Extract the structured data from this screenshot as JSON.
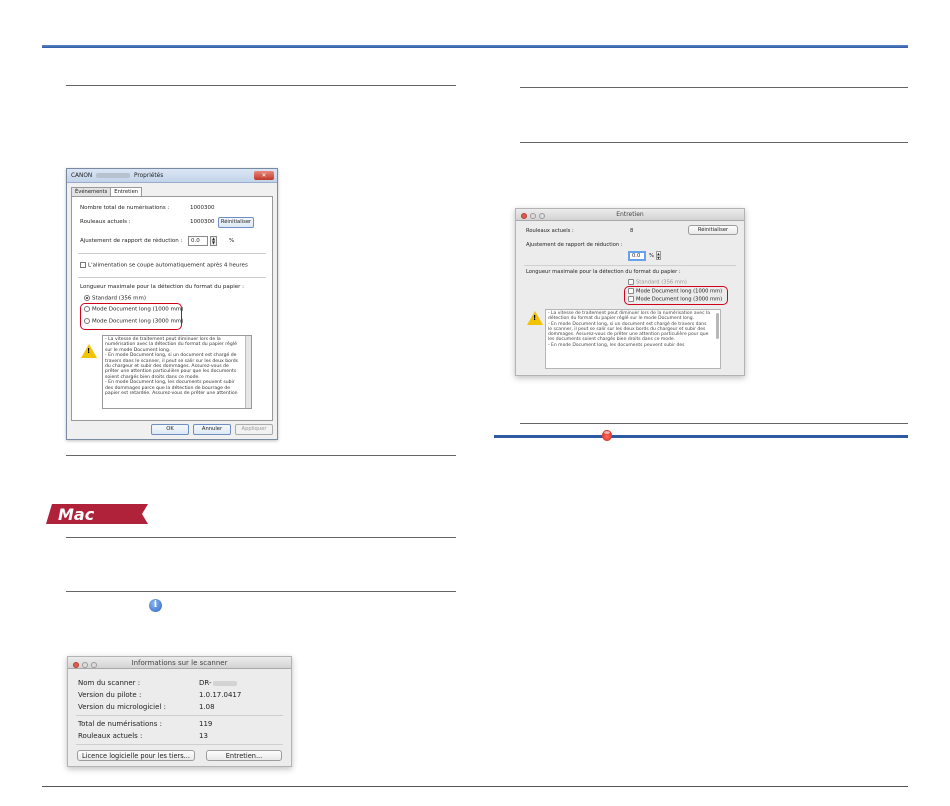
{
  "windows_dialog": {
    "title_prefix": "CANON",
    "title_suffix": "Propriétés",
    "close": "✕",
    "tabs": [
      "Événements",
      "Entretien"
    ],
    "total_scans_label": "Nombre total de numérisations :",
    "total_scans_value": "1000300",
    "rollers_label": "Rouleaux actuels :",
    "rollers_value": "1000300",
    "reset_button": "Réinitialiser",
    "reduction_label": "Ajustement de rapport de réduction :",
    "reduction_value": "0.0",
    "reduction_unit": "%",
    "power_off_label": "L'alimentation se coupe automatiquement après 4 heures",
    "max_length_label": "Longueur maximale pour la détection du format du papier :",
    "options": [
      "Standard (356 mm)",
      "Mode Document long (1000 mm)",
      "Mode Document long (3000 mm)"
    ],
    "message": "- La vitesse de traitement peut diminuer lors de la numérisation avec la détection du format du papier réglé sur le mode Document long.\n- En mode Document long, si un document est chargé de travers dans le scanner, il peut se salir sur les deux bords du chargeur et subir des dommages. Assurez-vous de prêter une attention particulière pour que les documents soient chargés bien droits dans ce mode.\n- En mode Document long, les documents peuvent subir des dommages parce que la détection de bourrage de papier est retardée. Assurez-vous de prêter une attention",
    "ok_button": "OK",
    "cancel_button": "Annuler",
    "apply_button": "Appliquer"
  },
  "mac_logo": {
    "text": "Mac",
    "color": "#b0213a"
  },
  "mac_maintenance": {
    "title": "Entretien",
    "rollers_label": "Rouleaux actuels :",
    "rollers_value": "8",
    "reset_button": "Réinitialiser",
    "reduction_label": "Ajustement de rapport de réduction :",
    "reduction_value": "0.0",
    "reduction_unit": "%",
    "max_length_label": "Longueur maximale pour la détection du format du papier :",
    "standard_option": "Standard (356 mm)",
    "options": [
      "Mode Document long (1000 mm)",
      "Mode Document long (3000 mm)"
    ],
    "message": "- La vitesse de traitement peut diminuer lors de la numérisation avec la détection du format du papier réglé sur le mode Document long.\n- En mode Document long, si un document est chargé de travers dans le scanner, il peut se salir sur les deux bords du chargeur et subir des dommages. Assurez-vous de prêter une attention particulière pour que les documents soient chargés bien droits dans ce mode.\n- En mode Document long, les documents peuvent subir des"
  },
  "mac_info": {
    "title": "Informations sur le scanner",
    "scanner_name_label": "Nom du scanner :",
    "scanner_name_value": "DR-",
    "driver_label": "Version du pilote :",
    "driver_value": "1.0.17.0417",
    "firmware_label": "Version du micrologiciel :",
    "firmware_value": "1.08",
    "total_scans_label": "Total de numérisations :",
    "total_scans_value": "119",
    "rollers_label": "Rouleaux actuels :",
    "rollers_value": "13",
    "license_button": "Licence logicielle pour les tiers...",
    "maintenance_button": "Entretien..."
  },
  "icons": {
    "info": "i"
  },
  "colors": {
    "accent": "#2e5aa3",
    "highlight": "#d0021b"
  }
}
